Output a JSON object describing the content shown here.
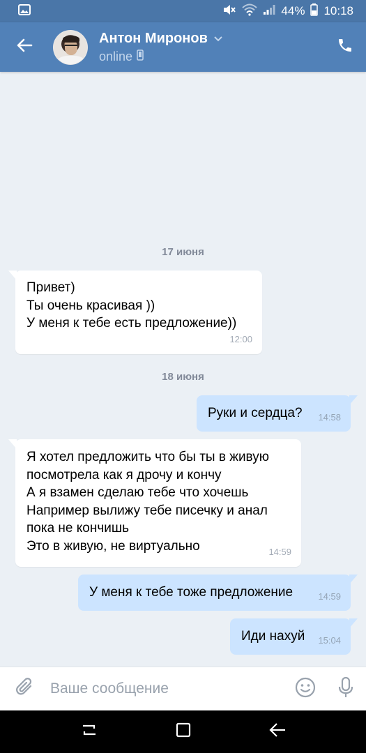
{
  "status_bar": {
    "battery": "44%",
    "time": "10:18"
  },
  "header": {
    "contact_name": "Антон Миронов",
    "status": "online"
  },
  "messages": [
    {
      "type": "date",
      "text": "17 июня"
    },
    {
      "type": "in",
      "text": "Привет)\nТы очень красивая ))\nУ меня к тебе есть предложение))",
      "time": "12:00"
    },
    {
      "type": "date",
      "text": "18 июня"
    },
    {
      "type": "out",
      "text": "Руки и сердца?",
      "time": "14:58"
    },
    {
      "type": "in",
      "text": "Я хотел предложить что бы ты в живую\nпосмотрела как я дрочу и кончу\nА я взамен сделаю тебе что хочешь\nНапример вылижу тебе писечку и анал\nпока не кончишь\nЭто в живую, не виртуально",
      "time": "14:59"
    },
    {
      "type": "out",
      "text": "У меня к тебе тоже предложение",
      "time": "14:59"
    },
    {
      "type": "out",
      "text": "Иди нахуй",
      "time": "15:04"
    }
  ],
  "input": {
    "placeholder": "Ваше сообщение"
  },
  "icons": {
    "gallery": "gallery-icon",
    "mute": "mute-icon",
    "wifi": "wifi-icon",
    "signal": "signal-icon",
    "battery": "battery-icon",
    "back": "back-arrow-icon",
    "dropdown": "chevron-down-icon",
    "mobile": "mobile-device-icon",
    "phone": "phone-icon",
    "attach": "paperclip-icon",
    "emoji": "emoji-icon",
    "mic": "microphone-icon",
    "recents": "recents-icon",
    "home": "home-icon",
    "nav_back": "nav-back-icon"
  },
  "colors": {
    "header": "#5181b8",
    "status_bar": "#4a76a8",
    "chat_bg": "#ebf0f5",
    "bubble_in": "#ffffff",
    "bubble_out": "#cce4ff"
  }
}
